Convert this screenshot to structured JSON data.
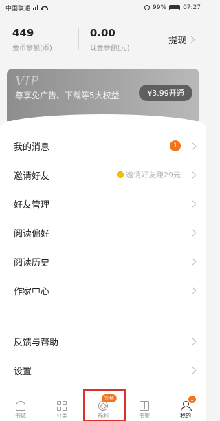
{
  "status_bar": {
    "carrier": "中国联通",
    "battery": "99%",
    "time": "07:27"
  },
  "wallet": {
    "coin_balance": "449",
    "coin_label": "金币余额(币)",
    "cash_balance": "0.00",
    "cash_label": "现金余额(元)",
    "withdraw_label": "提现"
  },
  "vip": {
    "mark": "VIP",
    "description": "尊享免广告、下载等5大权益",
    "button_label": "¥3.99开通"
  },
  "menu": {
    "messages": {
      "label": "我的消息",
      "badge": "1"
    },
    "invite": {
      "label": "邀请好友",
      "hint": "邀请好友赚29元"
    },
    "friends": {
      "label": "好友管理"
    },
    "preference": {
      "label": "阅读偏好"
    },
    "history": {
      "label": "阅读历史"
    },
    "author": {
      "label": "作家中心"
    },
    "feedback": {
      "label": "反馈与帮助"
    },
    "settings": {
      "label": "设置"
    }
  },
  "tabbar": {
    "bookstore": "书城",
    "category": "分类",
    "welfare": "福利",
    "welfare_badge": "签到",
    "shelf": "书架",
    "mine": "我的",
    "mine_badge": "1"
  },
  "colors": {
    "accent": "#f0751f",
    "highlight": "#d8332c"
  }
}
